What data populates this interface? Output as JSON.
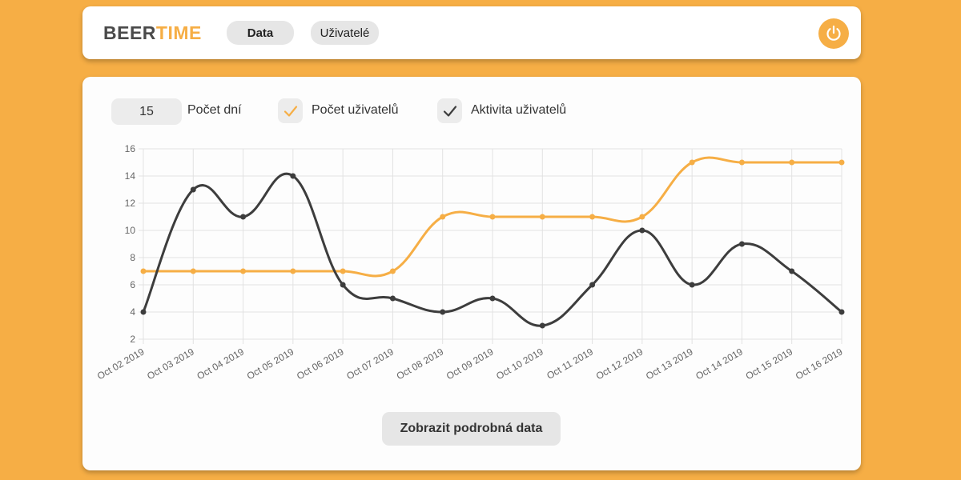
{
  "header": {
    "logo_part1": "BEER",
    "logo_part2": "TIME",
    "nav_data": "Data",
    "nav_users": "Uživatelé",
    "power_icon": "power-icon"
  },
  "controls": {
    "days_value": "15",
    "days_label": "Počet dní",
    "users_count_label": "Počet uživatelů",
    "users_activity_label": "Aktivita uživatelů",
    "check_icon": "checkmark-icon"
  },
  "button": {
    "detail_label": "Zobrazit podrobná data"
  },
  "colors": {
    "accent": "#f6ae45",
    "dark": "#3d3d3d",
    "grid": "#e2e2e2"
  },
  "chart_data": {
    "type": "line",
    "categories": [
      "Oct 02 2019",
      "Oct 03 2019",
      "Oct 04 2019",
      "Oct 05 2019",
      "Oct 06 2019",
      "Oct 07 2019",
      "Oct 08 2019",
      "Oct 09 2019",
      "Oct 10 2019",
      "Oct 11 2019",
      "Oct 12 2019",
      "Oct 13 2019",
      "Oct 14 2019",
      "Oct 15 2019",
      "Oct 16 2019"
    ],
    "series": [
      {
        "name": "Počet uživatelů",
        "color": "#f6ae45",
        "values": [
          7,
          7,
          7,
          7,
          7,
          7,
          11,
          11,
          11,
          11,
          11,
          15,
          15,
          15,
          15
        ]
      },
      {
        "name": "Aktivita uživatelů",
        "color": "#3d3d3d",
        "values": [
          4,
          13,
          11,
          14,
          6,
          5,
          4,
          5,
          3,
          6,
          10,
          6,
          9,
          7,
          4
        ]
      }
    ],
    "ylim": [
      2,
      16
    ],
    "yticks": [
      "2",
      "4",
      "6",
      "8",
      "10",
      "12",
      "14",
      "16"
    ],
    "grid": true,
    "legend": "none"
  }
}
